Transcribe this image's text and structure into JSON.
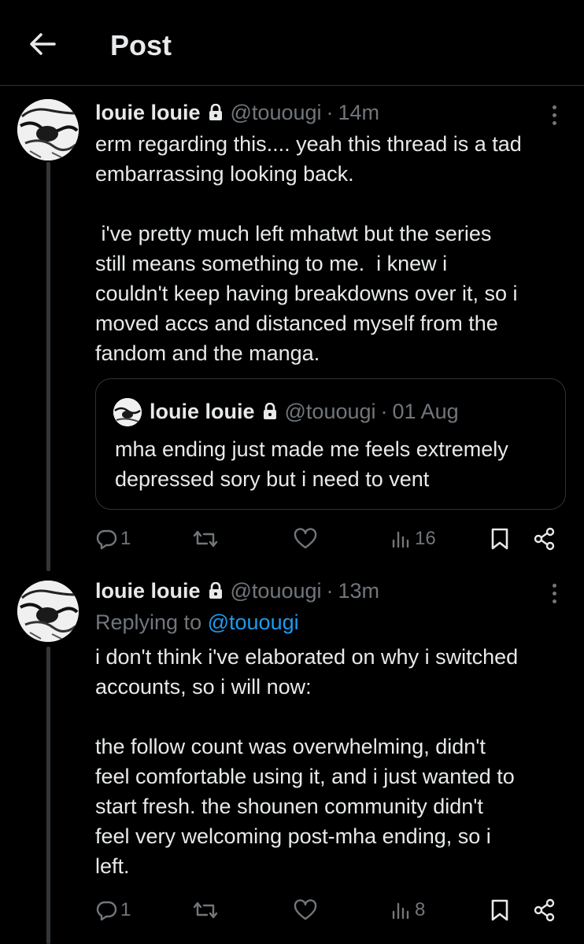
{
  "header": {
    "title": "Post"
  },
  "tweets": [
    {
      "name": "louie louie",
      "handle": "@touougi",
      "separator": "·",
      "time": "14m",
      "text": "erm regarding this.... yeah this thread is a tad\nembarrassing looking back.\n\n i've pretty much left mhatwt but the series\nstill means something to me.  i knew i\ncouldn't keep having breakdowns over it, so i\nmoved accs and distanced myself from the\nfandom and the manga.",
      "quote": {
        "name": "louie louie",
        "handle": "@touougi",
        "separator": "·",
        "time": "01 Aug",
        "text": "mha ending just made me feels extremely depressed sory but i need to vent"
      },
      "stats": {
        "replies": "1",
        "views": "16"
      }
    },
    {
      "name": "louie louie",
      "handle": "@touougi",
      "separator": "·",
      "time": "13m",
      "replying_prefix": "Replying to",
      "replying_to": "@touougi",
      "text": "i don't think i've elaborated on why i switched\naccounts, so i will now:\n\nthe follow count was overwhelming, didn't\nfeel comfortable using it, and i just wanted to\nstart fresh. the shounen community didn't\nfeel very welcoming post-mha ending, so i\nleft.",
      "stats": {
        "replies": "1",
        "views": "8"
      }
    }
  ],
  "icons": {
    "back": "arrow-left-icon",
    "lock": "lock-icon",
    "more": "more-vertical-icon",
    "reply": "reply-icon",
    "repost": "repost-icon",
    "like": "heart-icon",
    "views": "views-icon",
    "bookmark": "bookmark-icon",
    "share": "share-icon"
  },
  "colors": {
    "background": "#000000",
    "text": "#e7e9ea",
    "muted": "#71767b",
    "accent": "#1d9bf0",
    "border": "#2f3336"
  }
}
